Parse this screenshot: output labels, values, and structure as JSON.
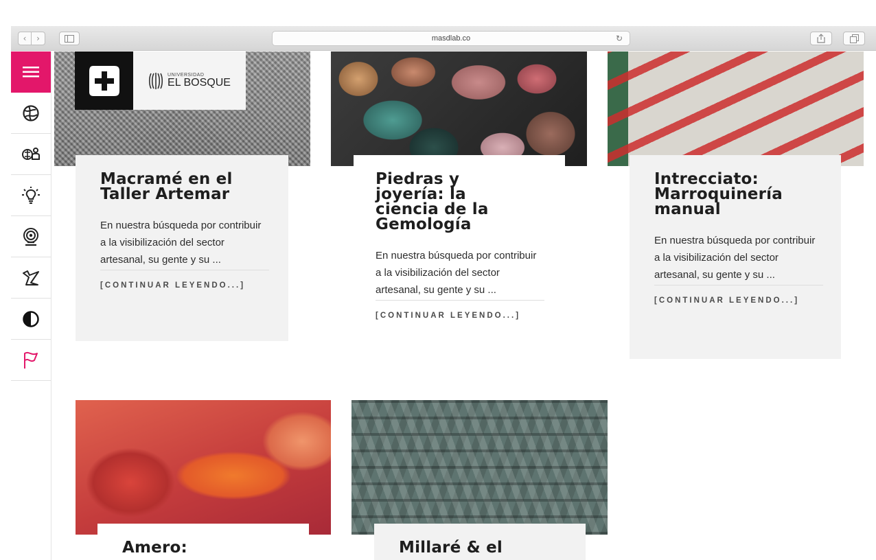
{
  "browser": {
    "url": "masdlab.co"
  },
  "sidenav": {
    "items": [
      {
        "icon": "menu-icon"
      },
      {
        "icon": "globe-icon"
      },
      {
        "icon": "people-icon"
      },
      {
        "icon": "lightbulb-icon"
      },
      {
        "icon": "broadcast-icon"
      },
      {
        "icon": "origami-bird-icon"
      },
      {
        "icon": "contrast-icon"
      },
      {
        "icon": "flag-icon"
      }
    ],
    "accent": "#e3176a"
  },
  "logo": {
    "university_small": "UNIVERSIDAD",
    "university_name": "EL BOSQUE"
  },
  "articles": [
    {
      "title": "Macramé en el Taller Artemar",
      "excerpt": "En nuestra búsqueda por contribuir a la visibilización del sector artesanal, su gente y su ...",
      "link": "[CONTINUAR LEYENDO...]"
    },
    {
      "title": "Piedras y joyería: la ciencia de la Gemología",
      "excerpt": "En nuestra búsqueda por contribuir a la visibilización del sector artesanal, su gente y su ...",
      "link": "[CONTINUAR LEYENDO...]"
    },
    {
      "title": "Intrecciato: Marroquinería manual",
      "excerpt": "En nuestra búsqueda por contribuir a la visibilización del sector artesanal, su gente y su ...",
      "link": "[CONTINUAR LEYENDO...]"
    },
    {
      "title": "Amero:",
      "excerpt": "",
      "link": ""
    },
    {
      "title": "Millaré & el",
      "excerpt": "",
      "link": ""
    }
  ]
}
